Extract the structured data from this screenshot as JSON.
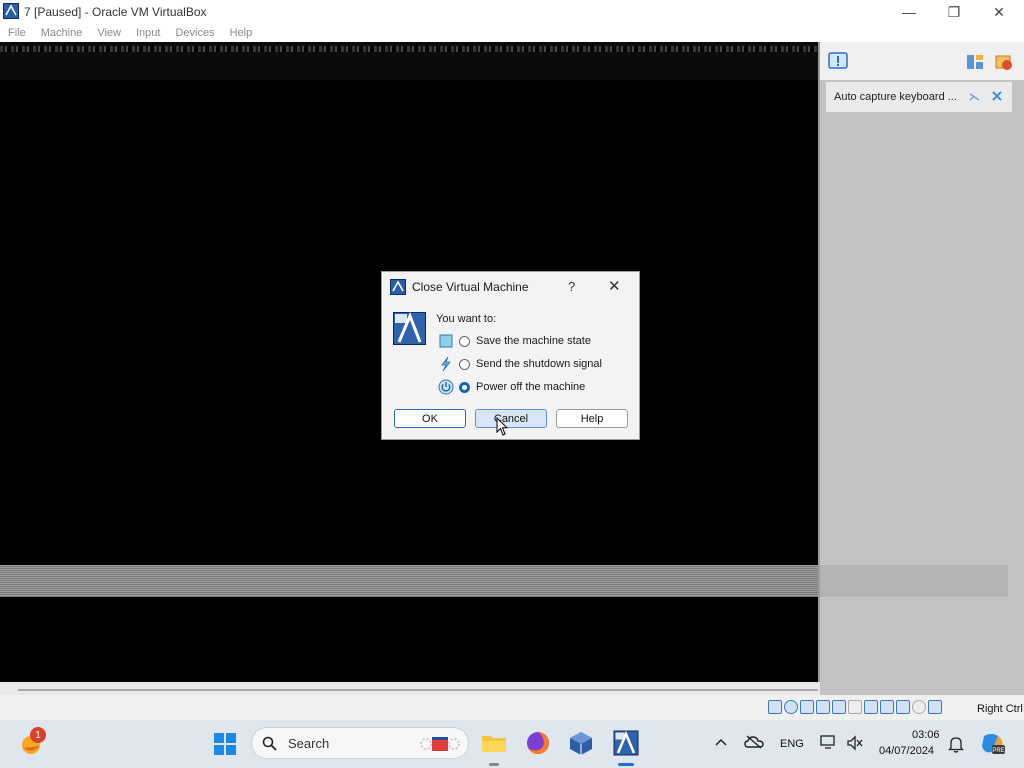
{
  "window": {
    "title": "7 [Paused] - Oracle VM VirtualBox",
    "controls": [
      "minimize",
      "restore",
      "close"
    ]
  },
  "menu": [
    "File",
    "Machine",
    "View",
    "Input",
    "Devices",
    "Help"
  ],
  "side_panel": {
    "notice": "Auto capture keyboard ..."
  },
  "dialog": {
    "title": "Close Virtual Machine",
    "help_glyph": "?",
    "prompt": "You want to:",
    "options": [
      {
        "label": "Save the machine state",
        "icon": "save-state-icon",
        "checked": false
      },
      {
        "label": "Send the shutdown signal",
        "icon": "shutdown-signal-icon",
        "checked": false
      },
      {
        "label": "Power off the machine",
        "icon": "power-off-icon",
        "checked": true
      }
    ],
    "buttons": {
      "ok": "OK",
      "cancel": "Cancel",
      "help": "Help"
    }
  },
  "statusbar": {
    "host_key": "Right Ctrl"
  },
  "taskbar": {
    "search_placeholder": "Search",
    "weather_badge": "1",
    "language": "ENG",
    "time": "03:06",
    "date": "04/07/2024"
  },
  "colors": {
    "accent": "#1565b7",
    "vm_background": "#000000",
    "side_panel": "#c3c3c3"
  }
}
